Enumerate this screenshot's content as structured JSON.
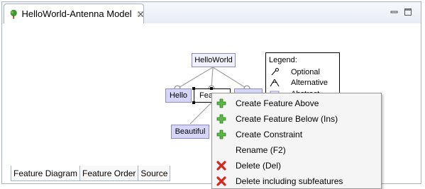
{
  "editor": {
    "tab_title": "HelloWorld-Antenna Model",
    "icons": {
      "tab": "tree-icon",
      "close": "close-icon",
      "minimize": "minimize-icon",
      "maximize": "maximize-icon"
    }
  },
  "diagram": {
    "root": "HelloWorld",
    "features": {
      "hello": "Hello",
      "feature_partial": "Fea",
      "beautiful": "Beautiful"
    },
    "legend": {
      "title": "Legend:",
      "optional": "Optional",
      "alternative": "Alternative",
      "abstract_partial": "Abstract"
    },
    "colors": {
      "concrete": "#d6d6fa",
      "abstract": "#f0f0fb",
      "line": "#a0a0a0"
    }
  },
  "context_menu": {
    "items": [
      {
        "label": "Create Feature Above",
        "icon": "plus-icon"
      },
      {
        "label": "Create Feature Below (Ins)",
        "icon": "plus-icon"
      },
      {
        "label": "Create Constraint",
        "icon": "plus-icon"
      },
      {
        "label": "Rename (F2)",
        "icon": ""
      },
      {
        "label": "Delete (Del)",
        "icon": "delete-icon"
      },
      {
        "label": "Delete including subfeatures",
        "icon": "delete-icon"
      }
    ]
  },
  "bottom_tabs": [
    {
      "label": "Feature Diagram",
      "active": true
    },
    {
      "label": "Feature Order",
      "active": false
    },
    {
      "label": "Source",
      "active": false
    }
  ]
}
